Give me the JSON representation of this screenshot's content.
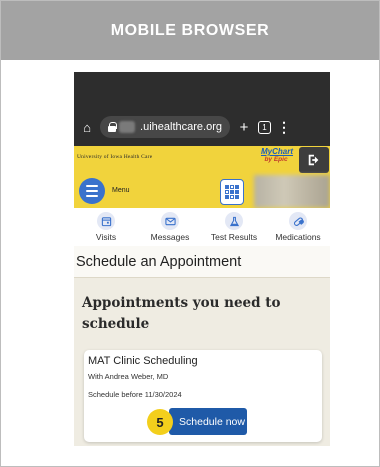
{
  "banner": {
    "title": "MOBILE BROWSER"
  },
  "browser": {
    "url": ".uihealthcare.org",
    "icons": [
      "home-icon",
      "lock-icon",
      "new-tab-icon",
      "tabs-icon",
      "more-menu-icon"
    ],
    "tab_count": "1"
  },
  "header": {
    "university": "University of Iowa Health Care",
    "mychart": "MyChart",
    "epic": "by Epic",
    "menu_label": "Menu"
  },
  "nav": {
    "items": [
      {
        "label": "Visits",
        "icon": "calendar-icon"
      },
      {
        "label": "Messages",
        "icon": "envelope-icon"
      },
      {
        "label": "Test Results",
        "icon": "flask-icon"
      },
      {
        "label": "Medications",
        "icon": "pill-icon"
      }
    ]
  },
  "page": {
    "title": "Schedule an Appointment",
    "section_heading": "Appointments you need to schedule"
  },
  "card": {
    "title": "MAT Clinic Scheduling",
    "provider": "With Andrea Weber, MD",
    "deadline": "Schedule before 11/30/2024",
    "button_label": "Schedule now",
    "step_number": "5"
  },
  "colors": {
    "banner": "#a3a3a3",
    "header_yellow": "#f1d33c",
    "button_blue": "#1f5aa8",
    "step_badge": "#f3cf1c"
  }
}
